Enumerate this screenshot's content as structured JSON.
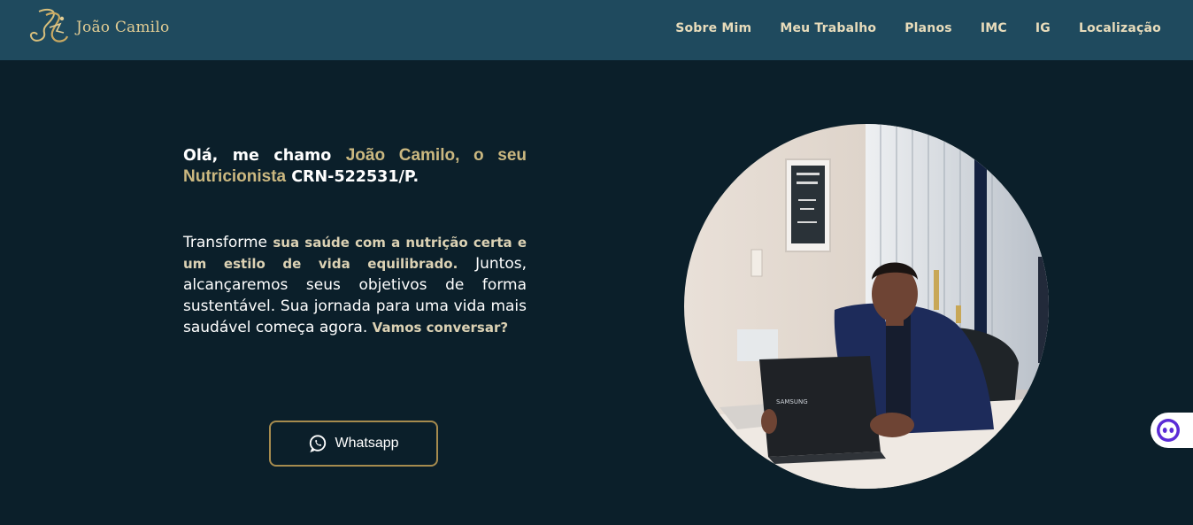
{
  "header": {
    "logo_text": "João Camilo",
    "nav": [
      "Sobre Mim",
      "Meu Trabalho",
      "Planos",
      "IMC",
      "IG",
      "Localização"
    ]
  },
  "hero": {
    "title_intro": "Olá, me chamo ",
    "title_highlight": "João Camilo, o seu Nutricionista",
    "title_crn": " CRN-522531/P.",
    "text_1": "Transforme ",
    "text_bold_1": "sua saúde com a nutrição certa e um estilo de vida equilibrado.",
    "text_2": " Juntos, alcançaremos seus objetivos de forma sustentável. Sua jornada para uma vida mais saudável começa agora. ",
    "text_bold_2": "Vamos conversar?",
    "whatsapp_label": "Whatsapp"
  },
  "colors": {
    "header_bg": "#1f4a5e",
    "page_bg": "#0b1f2a",
    "gold": "#cbb880",
    "button_border": "#a68b4e"
  },
  "icons": {
    "whatsapp": "whatsapp-icon",
    "chat": "chat-bot-icon"
  }
}
